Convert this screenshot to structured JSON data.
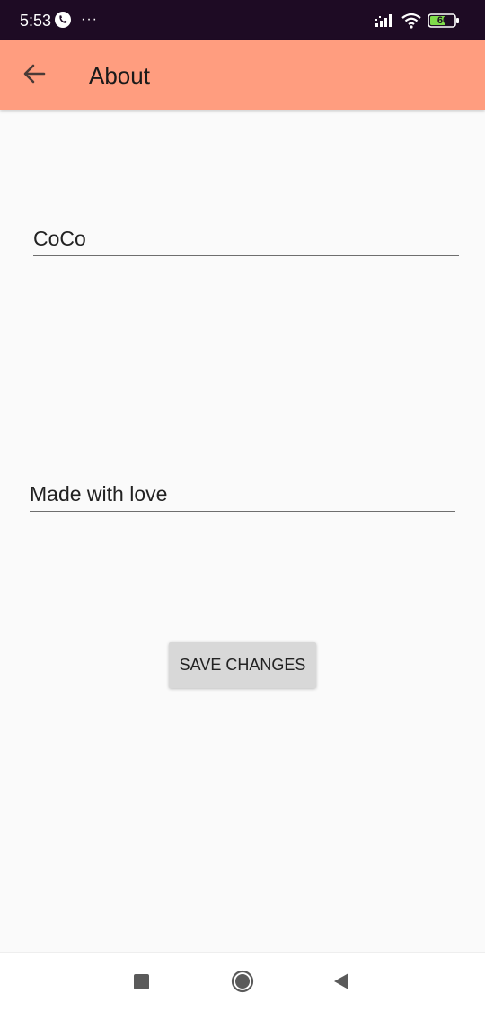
{
  "status_bar": {
    "time": "5:53",
    "battery_level": "60",
    "icons": [
      "call-icon",
      "more-icon",
      "signal-icon",
      "wifi-icon",
      "battery-icon"
    ]
  },
  "app_bar": {
    "title": "About",
    "back_icon": "arrow-left-icon",
    "background_color": "#ff9d7f"
  },
  "form": {
    "name_value": "CoCo",
    "about_value": "Made with love",
    "save_label": "SAVE CHANGES"
  },
  "nav_bar": {
    "icons": [
      "recents-square-icon",
      "home-circle-icon",
      "back-triangle-icon"
    ]
  }
}
